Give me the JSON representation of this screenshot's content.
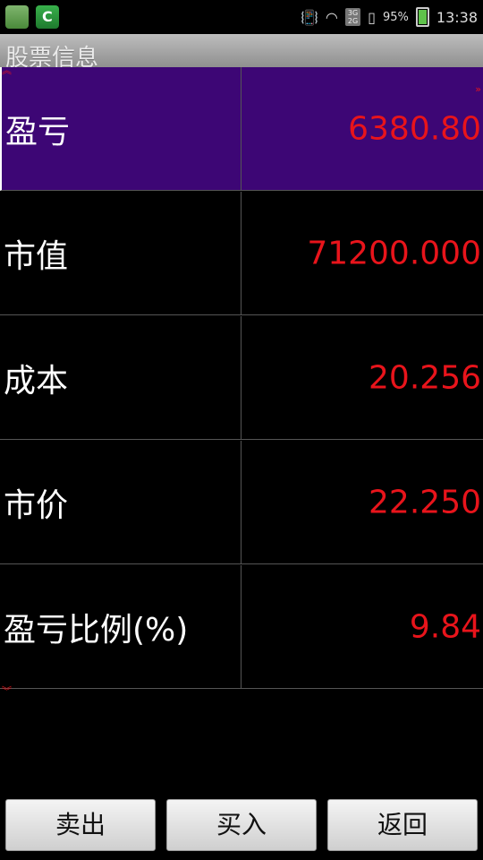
{
  "status_bar": {
    "battery": "95%",
    "time": "13:38",
    "network_top": "3G",
    "network_bottom": "2G"
  },
  "title": "股票信息",
  "rows": [
    {
      "label": "盈亏",
      "value": "6380.80"
    },
    {
      "label": "市值",
      "value": "71200.000"
    },
    {
      "label": "成本",
      "value": "20.256"
    },
    {
      "label": "市价",
      "value": "22.250"
    },
    {
      "label": "盈亏比例(%)",
      "value": "9.84"
    }
  ],
  "buttons": {
    "sell": "卖出",
    "buy": "买入",
    "back": "返回"
  },
  "colors": {
    "value_text": "#e8141b",
    "selected_row": "#3d0675",
    "background": "#000000"
  }
}
